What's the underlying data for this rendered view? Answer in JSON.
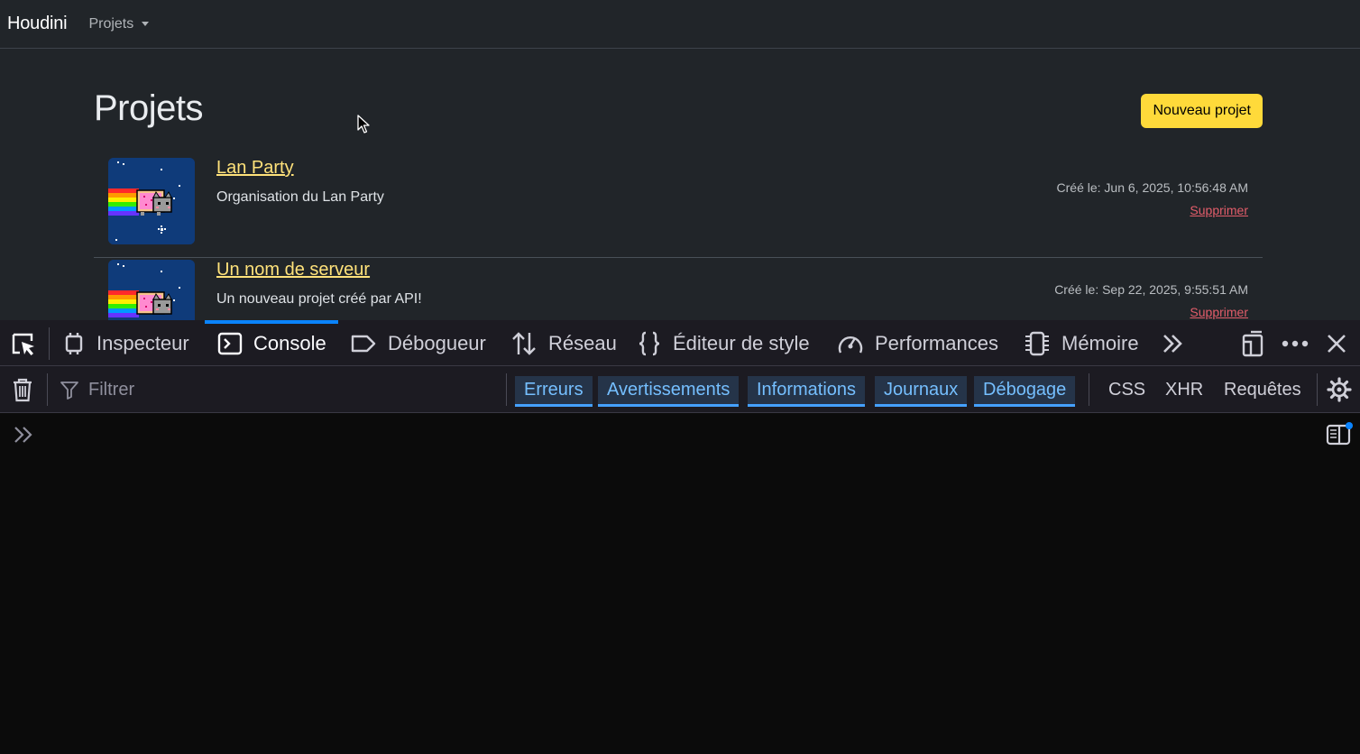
{
  "navbar": {
    "brand": "Houdini",
    "projects_menu": "Projets"
  },
  "page": {
    "title": "Projets",
    "new_project_button": "Nouveau projet"
  },
  "projects": [
    {
      "name": "Lan Party",
      "description": "Organisation du Lan Party",
      "created": "Créé le: Jun 6, 2025, 10:56:48 AM",
      "delete_label": "Supprimer"
    },
    {
      "name": "Un nom de serveur",
      "description": "Un nouveau projet créé par API!",
      "created": "Créé le: Sep 22, 2025, 9:55:51 AM",
      "delete_label": "Supprimer"
    }
  ],
  "devtools": {
    "tabs": [
      {
        "label": "Inspecteur",
        "icon": "inspector-icon"
      },
      {
        "label": "Console",
        "icon": "console-icon",
        "selected": true
      },
      {
        "label": "Débogueur",
        "icon": "debugger-icon"
      },
      {
        "label": "Réseau",
        "icon": "network-icon"
      },
      {
        "label": "Éditeur de style",
        "icon": "style-editor-icon"
      },
      {
        "label": "Performances",
        "icon": "performance-icon"
      },
      {
        "label": "Mémoire",
        "icon": "memory-icon"
      }
    ],
    "filter_placeholder": "Filtrer",
    "log_levels": [
      "Erreurs",
      "Avertissements",
      "Informations",
      "Journaux",
      "Débogage"
    ],
    "extra_filters": [
      "CSS",
      "XHR",
      "Requêtes"
    ]
  },
  "colors": {
    "page_bg": "#212529",
    "accent_yellow": "#ffda3a",
    "link_yellow": "#ffe27a",
    "danger": "#e35d6a",
    "devtools_toolbar": "#1c1b22",
    "devtools_selected": "#0a84ff",
    "chip_text": "#75bfff"
  }
}
